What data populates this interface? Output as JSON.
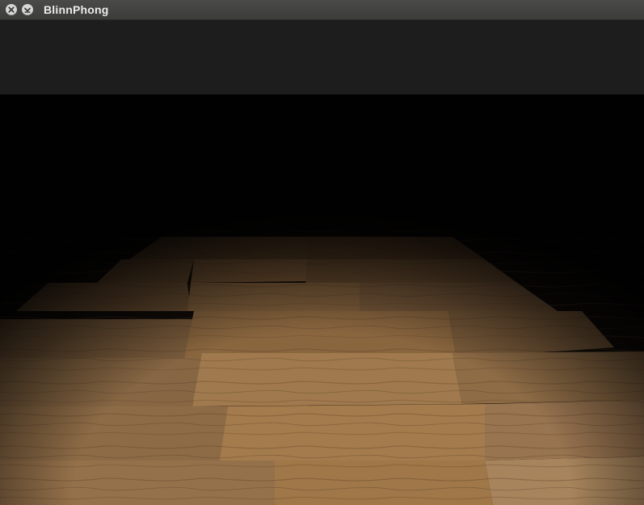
{
  "window": {
    "title": "BlinnPhong"
  },
  "titlebar_buttons": {
    "close_icon": "close-icon",
    "minimize_icon": "minimize-icon"
  },
  "scene": {
    "description_icon": "wood-floor-render",
    "colors": {
      "titlebar": "#3c3c3a",
      "background": "#1d1d1d",
      "wood_light": "#b8946a",
      "wood_dark": "#6b4a2a"
    }
  }
}
